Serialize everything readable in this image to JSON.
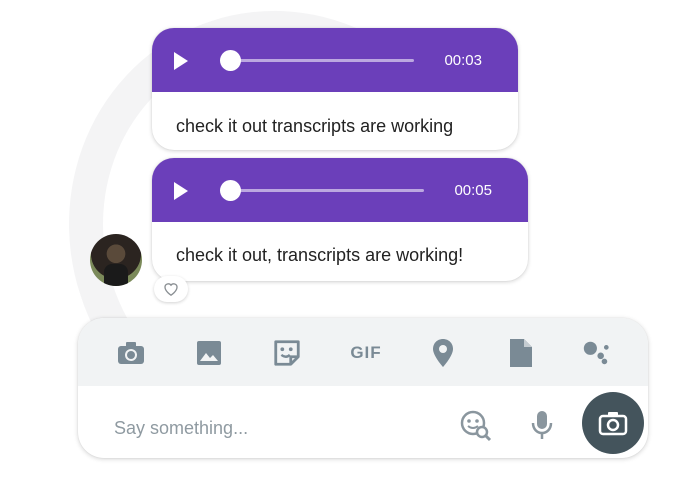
{
  "messages": [
    {
      "duration": "00:03",
      "transcript": "check it out transcripts are working"
    },
    {
      "duration": "00:05",
      "transcript": "check it out, transcripts are working!"
    }
  ],
  "composer": {
    "placeholder": "Say something...",
    "toolbar": {
      "camera_icon": "camera-icon",
      "gallery_icon": "image-icon",
      "sticker_icon": "sticker-icon",
      "gif_label": "GIF",
      "location_icon": "location-pin-icon",
      "file_icon": "file-icon",
      "assistant_icon": "assistant-icon"
    }
  },
  "colors": {
    "accent": "#6b3fba",
    "icon": "#7a8a95",
    "send_button": "#44545c"
  }
}
